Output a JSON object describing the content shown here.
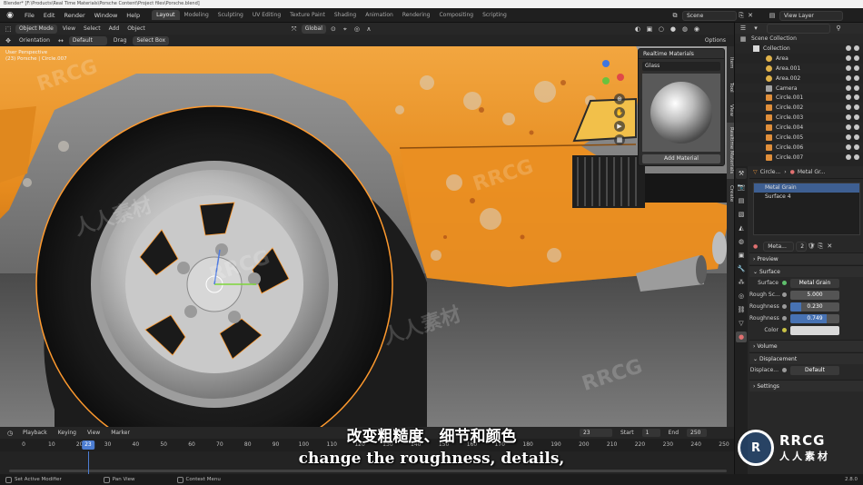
{
  "titlebar": {
    "text": "Blender* [F:\\Products\\Real Time Materials\\Porsche Content\\Project files\\Porsche.blend]"
  },
  "menubar": {
    "menus": [
      "File",
      "Edit",
      "Render",
      "Window",
      "Help"
    ],
    "workspaces": [
      "Layout",
      "Modeling",
      "Sculpting",
      "UV Editing",
      "Texture Paint",
      "Shading",
      "Animation",
      "Rendering",
      "Compositing",
      "Scripting"
    ],
    "active_workspace": "Layout",
    "scene_label": "Scene",
    "view_layer_label": "View Layer"
  },
  "viewport_header": {
    "mode": "Object Mode",
    "menus": [
      "View",
      "Select",
      "Add",
      "Object"
    ],
    "transform_orientation": "Global",
    "options_label": "Options"
  },
  "viewport_tools": {
    "orientation_label": "Orientation",
    "orientation_value": "Default",
    "drag_label": "Drag",
    "drag_value": "Select Box"
  },
  "viewport": {
    "overlay_line1": "User Perspective",
    "overlay_line2": "(23) Porsche | Circle.007",
    "side_tabs": [
      "Item",
      "Tool",
      "View",
      "Realtime Materials",
      "Create"
    ]
  },
  "realtime_materials": {
    "title": "Realtime Materials",
    "selected": "Glass",
    "add_button": "Add Material"
  },
  "outliner": {
    "scene_collection": "Scene Collection",
    "collection": "Collection",
    "items": [
      {
        "name": "Area",
        "type": "light"
      },
      {
        "name": "Area.001",
        "type": "light"
      },
      {
        "name": "Area.002",
        "type": "light"
      },
      {
        "name": "Camera",
        "type": "camera"
      },
      {
        "name": "Circle.001",
        "type": "mesh"
      },
      {
        "name": "Circle.002",
        "type": "mesh"
      },
      {
        "name": "Circle.003",
        "type": "mesh"
      },
      {
        "name": "Circle.004",
        "type": "mesh"
      },
      {
        "name": "Circle.005",
        "type": "mesh"
      },
      {
        "name": "Circle.006",
        "type": "mesh"
      },
      {
        "name": "Circle.007",
        "type": "mesh"
      }
    ]
  },
  "properties": {
    "object_name": "Circle...",
    "material_name": "Metal Gr...",
    "slots": [
      "Metal Grain",
      "Surface 4"
    ],
    "active_slot": "Metal Grain",
    "material_field": "Meta...",
    "material_users": "2",
    "panels": {
      "preview": "Preview",
      "surface": "Surface",
      "volume": "Volume",
      "displacement": "Displacement",
      "settings": "Settings"
    },
    "surface_label": "Surface",
    "surface_value": "Metal Grain",
    "params": [
      {
        "label": "Rough Sc...",
        "value": "5.000",
        "fill": 0.0
      },
      {
        "label": "Roughness",
        "value": "0.230",
        "fill": 0.23
      },
      {
        "label": "Roughness",
        "value": "0.749",
        "fill": 0.749
      },
      {
        "label": "Color",
        "value": "",
        "fill": 0.0
      }
    ],
    "displacement_label": "Displace...",
    "displacement_value": "Default"
  },
  "timeline": {
    "menus": [
      "Playback",
      "Keying",
      "View",
      "Marker"
    ],
    "current_frame": "23",
    "start_label": "Start",
    "start_value": "1",
    "end_label": "End",
    "end_value": "250",
    "ticks": [
      "0",
      "10",
      "20",
      "30",
      "40",
      "50",
      "60",
      "70",
      "80",
      "90",
      "100",
      "110",
      "120",
      "130",
      "140",
      "150",
      "160",
      "170",
      "180",
      "190",
      "200",
      "210",
      "220",
      "230",
      "240",
      "250"
    ]
  },
  "statusbar": {
    "items": [
      "Set Active Modifier",
      "Pan View",
      "Context Menu"
    ],
    "version": "2.8.0"
  },
  "subtitles": {
    "cn": "改变粗糙度、细节和颜色",
    "en": "change the roughness, details,"
  },
  "watermark": {
    "brand_en": "RRCG",
    "brand_cn": "人人素材"
  },
  "colors": {
    "accent_blue": "#4772b3",
    "car_orange": "#e8921f",
    "selection_outline": "#ff9a2e"
  }
}
